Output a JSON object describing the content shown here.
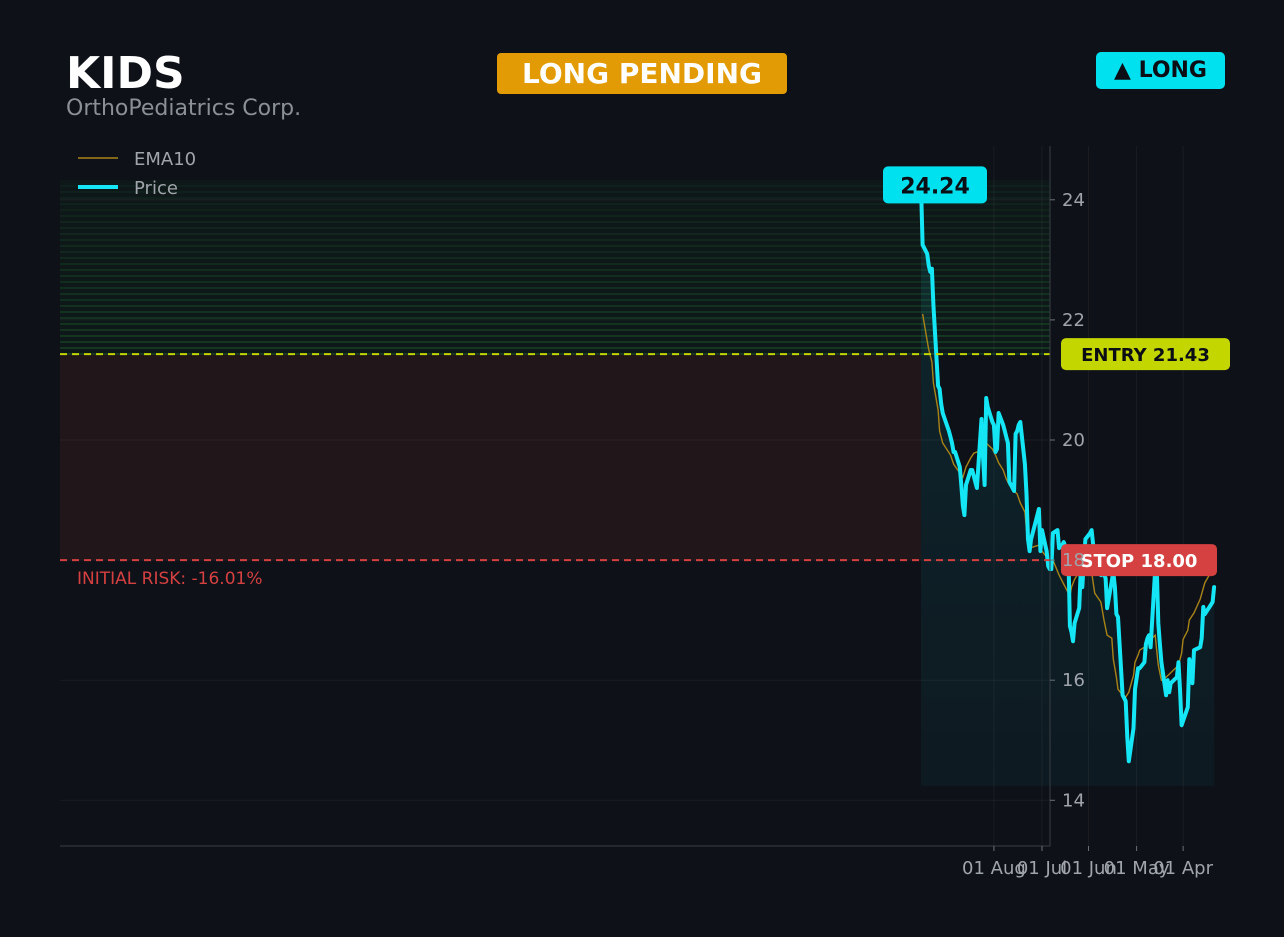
{
  "header": {
    "ticker": "KIDS",
    "company": "OrthoPediatrics Corp.",
    "status": "LONG PENDING",
    "side": "▲ LONG"
  },
  "colors": {
    "background": "#0e1118",
    "price": "#14e6f6",
    "ema": "#a88418",
    "entry": "#c4d600",
    "stop": "#d54040",
    "status": "#e29b04",
    "side": "#00e1f0"
  },
  "chart_data": {
    "type": "line",
    "ylim": [
      13.8,
      25.4
    ],
    "y_ticks": [
      14,
      16,
      18,
      20,
      22,
      24
    ],
    "x_tick_labels": [
      "01 Apr",
      "01 May",
      "01 Jun",
      "01 Jul",
      "01 Aug"
    ],
    "x_tick_dates": [
      "2024-04-01",
      "2024-05-01",
      "2024-06-01",
      "2024-07-01",
      "2024-08-01"
    ],
    "xlim": [
      "2024-03-05",
      "2024-08-19"
    ],
    "grid": true,
    "legend_position": "top-left",
    "last_price_label": "24.24",
    "entry": {
      "value": 21.43,
      "label": "ENTRY 21.43"
    },
    "stop": {
      "value": 18.0,
      "label": "STOP 18.00"
    },
    "risk_label": "INITIAL RISK: -16.01%",
    "series": [
      {
        "name": "Price",
        "points": [
          [
            "2024-03-12",
            17.55
          ],
          [
            "2024-03-13",
            17.3
          ],
          [
            "2024-03-15",
            17.22
          ],
          [
            "2024-03-18",
            17.1
          ],
          [
            "2024-03-19",
            17.22
          ],
          [
            "2024-03-20",
            16.7
          ],
          [
            "2024-03-21",
            16.55
          ],
          [
            "2024-03-25",
            16.5
          ],
          [
            "2024-03-26",
            15.95
          ],
          [
            "2024-03-27",
            16.25
          ],
          [
            "2024-03-28",
            16.35
          ],
          [
            "2024-03-29",
            15.55
          ],
          [
            "2024-04-02",
            15.25
          ],
          [
            "2024-04-03",
            15.85
          ],
          [
            "2024-04-04",
            16.3
          ],
          [
            "2024-04-05",
            16.05
          ],
          [
            "2024-04-09",
            15.95
          ],
          [
            "2024-04-10",
            15.8
          ],
          [
            "2024-04-11",
            16.0
          ],
          [
            "2024-04-12",
            15.75
          ],
          [
            "2024-04-15",
            16.3
          ],
          [
            "2024-04-16",
            16.6
          ],
          [
            "2024-04-17",
            16.95
          ],
          [
            "2024-04-18",
            17.85
          ],
          [
            "2024-04-19",
            17.85
          ],
          [
            "2024-04-22",
            16.55
          ],
          [
            "2024-04-23",
            16.75
          ],
          [
            "2024-04-24",
            16.7
          ],
          [
            "2024-04-25",
            16.6
          ],
          [
            "2024-04-26",
            16.3
          ],
          [
            "2024-04-29",
            16.2
          ],
          [
            "2024-04-30",
            16.2
          ],
          [
            "2024-05-02",
            15.85
          ],
          [
            "2024-05-03",
            15.2
          ],
          [
            "2024-05-06",
            14.65
          ],
          [
            "2024-05-07",
            15.05
          ],
          [
            "2024-05-08",
            15.65
          ],
          [
            "2024-05-09",
            15.7
          ],
          [
            "2024-05-10",
            15.75
          ],
          [
            "2024-05-13",
            17.05
          ],
          [
            "2024-05-14",
            17.1
          ],
          [
            "2024-05-15",
            17.55
          ],
          [
            "2024-05-16",
            17.8
          ],
          [
            "2024-05-17",
            17.65
          ],
          [
            "2024-05-20",
            17.2
          ],
          [
            "2024-05-21",
            17.7
          ],
          [
            "2024-05-22",
            17.75
          ],
          [
            "2024-05-23",
            17.9
          ],
          [
            "2024-05-24",
            17.75
          ],
          [
            "2024-05-28",
            18.15
          ],
          [
            "2024-05-29",
            18.25
          ],
          [
            "2024-05-30",
            18.5
          ],
          [
            "2024-05-31",
            18.45
          ],
          [
            "2024-06-03",
            18.35
          ],
          [
            "2024-06-04",
            18.0
          ],
          [
            "2024-06-05",
            17.55
          ],
          [
            "2024-06-06",
            17.85
          ],
          [
            "2024-06-07",
            17.2
          ],
          [
            "2024-06-10",
            16.95
          ],
          [
            "2024-06-11",
            16.65
          ],
          [
            "2024-06-12",
            16.8
          ],
          [
            "2024-06-13",
            16.9
          ],
          [
            "2024-06-14",
            18.1
          ],
          [
            "2024-06-17",
            18.3
          ],
          [
            "2024-06-18",
            18.25
          ],
          [
            "2024-06-20",
            18.2
          ],
          [
            "2024-06-21",
            18.5
          ],
          [
            "2024-06-24",
            18.45
          ],
          [
            "2024-06-25",
            17.85
          ],
          [
            "2024-06-26",
            17.85
          ],
          [
            "2024-06-27",
            17.9
          ],
          [
            "2024-06-28",
            18.15
          ],
          [
            "2024-07-01",
            18.5
          ],
          [
            "2024-07-02",
            18.15
          ],
          [
            "2024-07-03",
            18.85
          ],
          [
            "2024-07-05",
            18.65
          ],
          [
            "2024-07-08",
            18.35
          ],
          [
            "2024-07-09",
            18.15
          ],
          [
            "2024-07-10",
            18.35
          ],
          [
            "2024-07-11",
            19.1
          ],
          [
            "2024-07-12",
            19.6
          ],
          [
            "2024-07-15",
            20.3
          ],
          [
            "2024-07-16",
            20.25
          ],
          [
            "2024-07-17",
            20.15
          ],
          [
            "2024-07-18",
            20.1
          ],
          [
            "2024-07-19",
            19.15
          ],
          [
            "2024-07-22",
            19.3
          ],
          [
            "2024-07-23",
            19.95
          ],
          [
            "2024-07-24",
            20.05
          ],
          [
            "2024-07-25",
            20.15
          ],
          [
            "2024-07-26",
            20.25
          ],
          [
            "2024-07-29",
            20.45
          ],
          [
            "2024-07-30",
            19.85
          ],
          [
            "2024-07-31",
            19.8
          ],
          [
            "2024-08-01",
            20.25
          ],
          [
            "2024-08-02",
            20.3
          ],
          [
            "2024-08-05",
            20.55
          ],
          [
            "2024-08-06",
            20.7
          ],
          [
            "2024-08-07",
            19.25
          ],
          [
            "2024-08-08",
            19.7
          ],
          [
            "2024-08-09",
            20.35
          ],
          [
            "2024-08-12",
            19.2
          ],
          [
            "2024-08-13",
            19.3
          ],
          [
            "2024-08-14",
            19.4
          ],
          [
            "2024-08-15",
            19.5
          ],
          [
            "2024-08-16",
            19.5
          ],
          [
            "2024-08-19",
            19.25
          ],
          [
            "2024-08-20",
            18.75
          ],
          [
            "2024-08-21",
            18.9
          ],
          [
            "2024-08-22",
            19.25
          ],
          [
            "2024-08-23",
            19.55
          ],
          [
            "2024-08-26",
            19.8
          ],
          [
            "2024-08-27",
            19.8
          ],
          [
            "2024-08-28",
            19.95
          ],
          [
            "2024-08-29",
            20.05
          ],
          [
            "2024-08-30",
            20.15
          ],
          [
            "2024-09-03",
            20.45
          ],
          [
            "2024-09-04",
            20.6
          ],
          [
            "2024-09-05",
            20.85
          ],
          [
            "2024-09-06",
            20.9
          ],
          [
            "2024-09-09",
            22.25
          ],
          [
            "2024-09-10",
            22.85
          ],
          [
            "2024-09-11",
            22.8
          ],
          [
            "2024-09-12",
            22.9
          ],
          [
            "2024-09-13",
            23.1
          ],
          [
            "2024-09-16",
            23.25
          ],
          [
            "2024-09-17",
            24.24
          ]
        ]
      },
      {
        "name": "EMA10",
        "points": [
          [
            "2024-03-12",
            17.95
          ],
          [
            "2024-03-14",
            17.8
          ],
          [
            "2024-03-18",
            17.62
          ],
          [
            "2024-03-21",
            17.35
          ],
          [
            "2024-03-25",
            17.12
          ],
          [
            "2024-03-28",
            17.0
          ],
          [
            "2024-03-29",
            16.83
          ],
          [
            "2024-04-01",
            16.68
          ],
          [
            "2024-04-02",
            16.45
          ],
          [
            "2024-04-04",
            16.25
          ],
          [
            "2024-04-08",
            16.15
          ],
          [
            "2024-04-10",
            16.1
          ],
          [
            "2024-04-12",
            16.05
          ],
          [
            "2024-04-15",
            16.0
          ],
          [
            "2024-04-16",
            16.12
          ],
          [
            "2024-04-17",
            16.25
          ],
          [
            "2024-04-18",
            16.48
          ],
          [
            "2024-04-19",
            16.75
          ],
          [
            "2024-04-22",
            16.68
          ],
          [
            "2024-04-24",
            16.7
          ],
          [
            "2024-04-26",
            16.55
          ],
          [
            "2024-04-29",
            16.5
          ],
          [
            "2024-04-30",
            16.42
          ],
          [
            "2024-05-02",
            16.3
          ],
          [
            "2024-05-03",
            16.08
          ],
          [
            "2024-05-06",
            15.8
          ],
          [
            "2024-05-08",
            15.72
          ],
          [
            "2024-05-10",
            15.75
          ],
          [
            "2024-05-13",
            15.85
          ],
          [
            "2024-05-14",
            16.05
          ],
          [
            "2024-05-16",
            16.35
          ],
          [
            "2024-05-17",
            16.7
          ],
          [
            "2024-05-20",
            16.75
          ],
          [
            "2024-05-22",
            17.0
          ],
          [
            "2024-05-24",
            17.3
          ],
          [
            "2024-05-28",
            17.45
          ],
          [
            "2024-05-30",
            17.8
          ],
          [
            "2024-05-31",
            17.95
          ],
          [
            "2024-06-03",
            17.98
          ],
          [
            "2024-06-06",
            17.85
          ],
          [
            "2024-06-10",
            17.68
          ],
          [
            "2024-06-12",
            17.55
          ],
          [
            "2024-06-13",
            17.4
          ],
          [
            "2024-06-17",
            17.6
          ],
          [
            "2024-06-20",
            17.75
          ],
          [
            "2024-06-24",
            18.0
          ],
          [
            "2024-06-26",
            17.95
          ],
          [
            "2024-06-28",
            18.05
          ],
          [
            "2024-07-01",
            18.15
          ],
          [
            "2024-07-03",
            18.25
          ],
          [
            "2024-07-09",
            18.2
          ],
          [
            "2024-07-11",
            18.5
          ],
          [
            "2024-07-12",
            18.8
          ],
          [
            "2024-07-15",
            18.95
          ],
          [
            "2024-07-17",
            19.1
          ],
          [
            "2024-07-19",
            19.15
          ],
          [
            "2024-07-22",
            19.25
          ],
          [
            "2024-07-24",
            19.35
          ],
          [
            "2024-07-26",
            19.5
          ],
          [
            "2024-07-29",
            19.62
          ],
          [
            "2024-07-31",
            19.75
          ],
          [
            "2024-08-02",
            19.85
          ],
          [
            "2024-08-06",
            19.95
          ],
          [
            "2024-08-08",
            19.85
          ],
          [
            "2024-08-12",
            19.8
          ],
          [
            "2024-08-14",
            19.78
          ],
          [
            "2024-08-16",
            19.7
          ],
          [
            "2024-08-19",
            19.55
          ],
          [
            "2024-08-21",
            19.38
          ],
          [
            "2024-08-23",
            19.45
          ],
          [
            "2024-08-27",
            19.6
          ],
          [
            "2024-08-29",
            19.75
          ],
          [
            "2024-09-03",
            19.95
          ],
          [
            "2024-09-05",
            20.15
          ],
          [
            "2024-09-06",
            20.5
          ],
          [
            "2024-09-09",
            20.95
          ],
          [
            "2024-09-10",
            21.3
          ],
          [
            "2024-09-12",
            21.5
          ],
          [
            "2024-09-13",
            21.65
          ],
          [
            "2024-09-16",
            22.1
          ]
        ]
      }
    ]
  }
}
